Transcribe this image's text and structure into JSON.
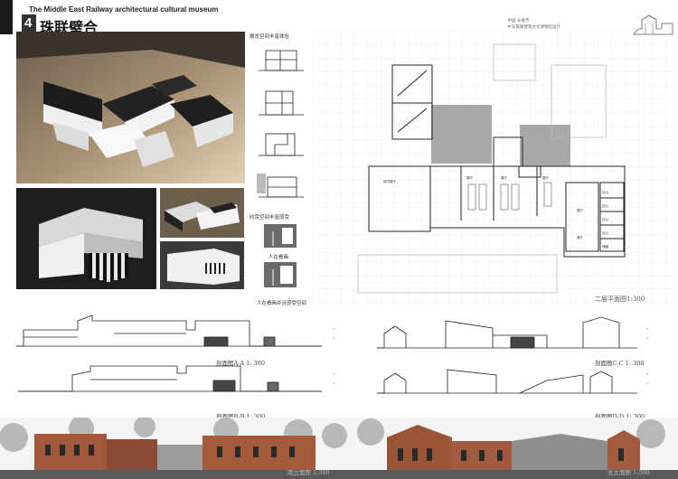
{
  "header": {
    "sheet_number": "4",
    "title_en": "The Middle East Railway architectural cultural museum",
    "title_cn": "珠联璧合",
    "top_right_line1": "中国 长春市",
    "top_right_line2": "中东铁路建筑文化博物馆设计"
  },
  "diagrams": {
    "caption_top": "展览空间丰富体验",
    "caption_mid": "欣赏空间丰富感受",
    "caption_person": "人在看画",
    "caption_bottom": "人在看画并且感受空间"
  },
  "plan": {
    "caption": "二层平面图1:300"
  },
  "sections": {
    "aa": "剖面图A-A 1: 300",
    "bb": "剖面图B-B 1: 300",
    "cc": "剖面图C-C 1: 300",
    "dd": "剖面图D-D 1: 300"
  },
  "elevations": {
    "left": "南立面图 1:300",
    "right": "北立面图 1:300"
  }
}
